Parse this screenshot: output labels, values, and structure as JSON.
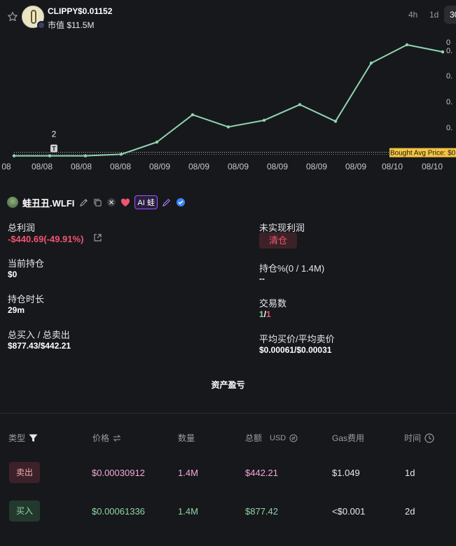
{
  "header": {
    "token_name": "CLIPPY",
    "token_price": "$0.01152",
    "market_cap": "市值 $11.5M",
    "timeframes": [
      "4h",
      "1d",
      "30"
    ],
    "active_timeframe": "30"
  },
  "chart_data": {
    "type": "line",
    "x": [
      "08/08",
      "08/08",
      "08/08",
      "08/08",
      "08/09",
      "08/09",
      "08/09",
      "08/09",
      "08/09",
      "08/09",
      "08/10",
      "08/10"
    ],
    "x_ticks": [
      "08",
      "08/08",
      "08/08",
      "08/08",
      "08/09",
      "08/09",
      "08/09",
      "08/09",
      "08/09",
      "08/09",
      "08/10",
      "08/10"
    ],
    "y_ticks": [
      "0",
      "0.",
      "0.",
      "0.",
      "0."
    ],
    "series": [
      {
        "values": [
          0.0002,
          0.0002,
          0.0002,
          0.0005,
          0.0029,
          0.0083,
          0.0059,
          0.0072,
          0.0103,
          0.007,
          0.0185,
          0.0221,
          0.0207
        ]
      }
    ],
    "line_color": "#8ed6b0",
    "annotations": [
      {
        "label": "2",
        "marker": "T"
      },
      {
        "label": "Bought Avg Price: $0",
        "color": "#f5c542"
      }
    ]
  },
  "profile": {
    "name": "蛙丑丑.WLFI",
    "badge": "AI 蛙"
  },
  "stats": {
    "total_profit_label": "总利润",
    "total_profit_value": "-$440.69(-49.91%)",
    "unrealized_label": "未实现利润",
    "clear_button": "清仓",
    "holding_label": "当前持仓",
    "holding_value": "$0",
    "holding_pct_label": "持仓%(0 / 1.4M)",
    "holding_pct_value": "--",
    "duration_label": "持仓时长",
    "duration_value": "29m",
    "trades_label": "交易数",
    "trades_buy": "1",
    "trades_sep": "/",
    "trades_sell": "1",
    "buy_sell_total_label": "总买入 / 总卖出",
    "buy_sell_total_value": "$877.43/$442.21",
    "avg_price_label": "平均买价/平均卖价",
    "avg_price_value": "$0.00061/$0.00031"
  },
  "tab_label": "资产盈亏",
  "table": {
    "headers": {
      "type": "类型",
      "price": "价格",
      "qty": "数量",
      "total": "总额",
      "total_unit": "USD",
      "gas": "Gas费用",
      "time": "时间"
    },
    "rows": [
      {
        "type": "卖出",
        "price": "$0.00030912",
        "qty": "1.4M",
        "total": "$442.21",
        "gas": "$1.049",
        "time": "1d"
      },
      {
        "type": "买入",
        "price": "$0.00061336",
        "qty": "1.4M",
        "total": "$877.42",
        "gas": "<$0.001",
        "time": "2d"
      }
    ]
  },
  "colors": {
    "background": "#17181c",
    "negative": "#f2546f",
    "positive": "#8ed6a3",
    "sell_price": "#f5a9d8",
    "avg_price_line": "#f5c542"
  }
}
